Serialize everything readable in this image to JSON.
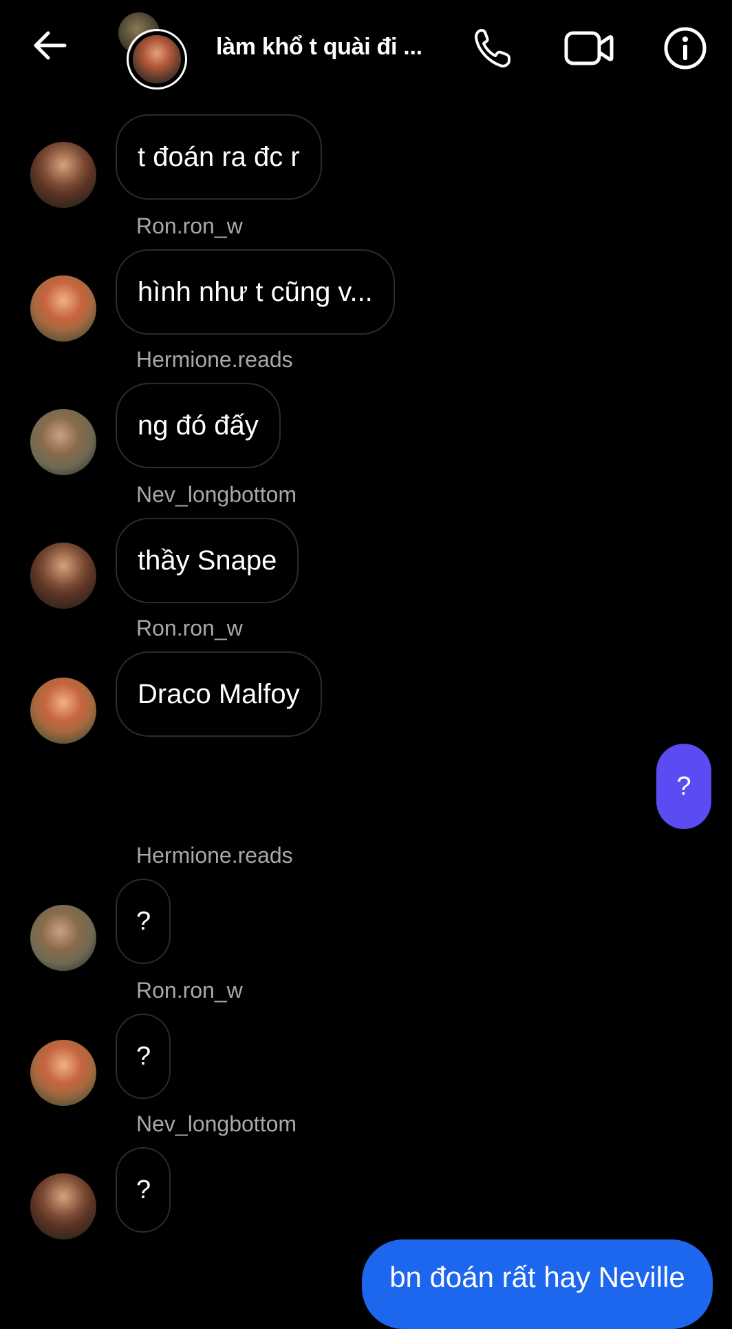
{
  "header": {
    "title": "làm khổ t quài đi ...",
    "back_icon": "arrow-left-icon",
    "call_icon": "phone-icon",
    "video_icon": "video-camera-icon",
    "info_icon": "info-icon"
  },
  "messages": [
    {
      "sender": "",
      "text": "t đoán ra đc r"
    },
    {
      "sender": "Ron.ron_w",
      "text": "hình như t cũng v..."
    },
    {
      "sender": "Hermione.reads",
      "text": "ng đó đấy"
    },
    {
      "sender": "Nev_longbottom",
      "text": "thầy Snape"
    },
    {
      "sender": "Ron.ron_w",
      "text": "Draco Malfoy"
    },
    {
      "sender": "Hermione.reads",
      "text": "?"
    },
    {
      "sender": "Ron.ron_w",
      "text": "?"
    },
    {
      "sender": "Nev_longbottom",
      "text": "?"
    }
  ],
  "outgoing": [
    {
      "text": "?",
      "color": "#5a4cf2"
    },
    {
      "text": "bn đoán rất hay Neville",
      "color": "#1d67ee"
    }
  ],
  "colors": {
    "background": "#000000",
    "bubble_border": "#2c2c2c",
    "sender_text": "#a8a8a8"
  }
}
